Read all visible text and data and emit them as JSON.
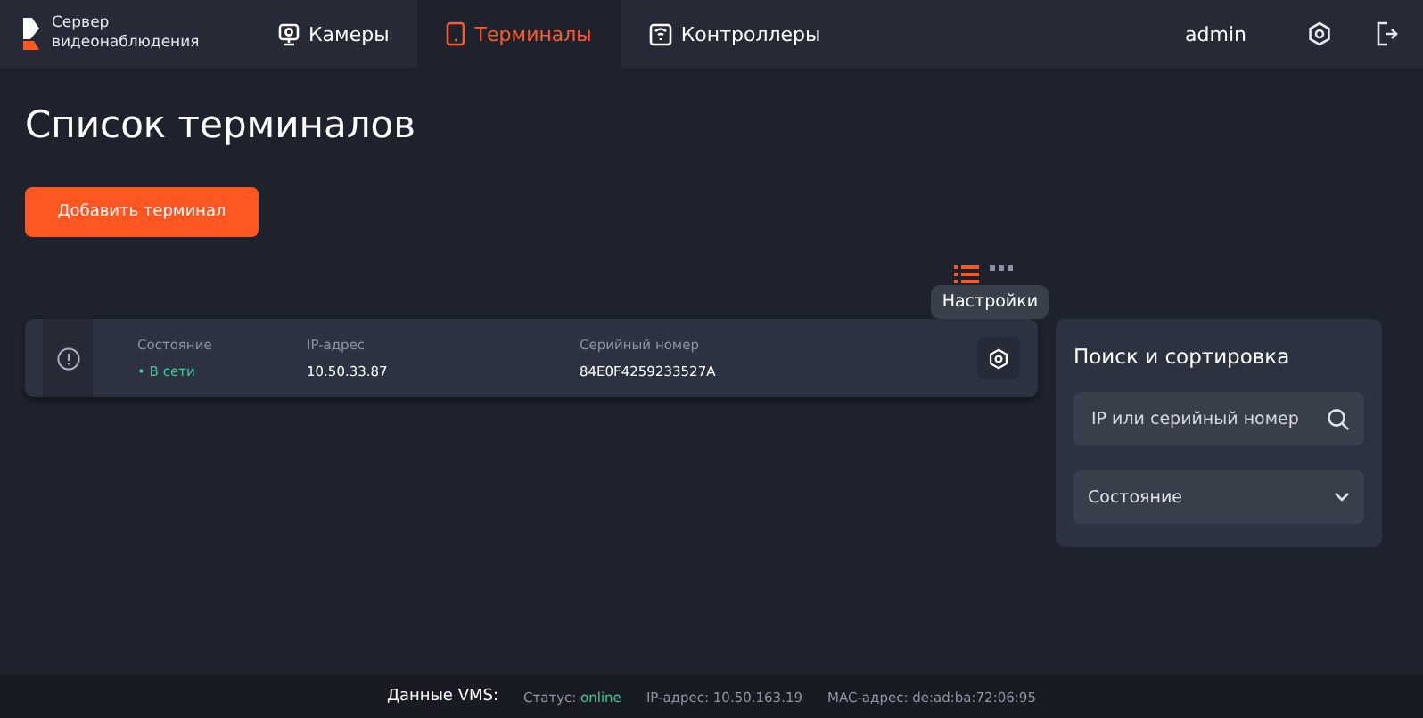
{
  "header": {
    "logo_text": "Сервер видеонаблюдения",
    "nav": [
      {
        "label": "Камеры",
        "selected": false
      },
      {
        "label": "Терминалы",
        "selected": true
      },
      {
        "label": "Контроллеры",
        "selected": false
      }
    ],
    "user": "admin"
  },
  "title": "Список терминалов",
  "add_button": "Добавить терминал",
  "view_toggles": [
    {
      "kind": "list",
      "selected": true
    },
    {
      "kind": "grid",
      "selected": false
    }
  ],
  "tooltip": "Настройки",
  "terminals": [
    {
      "online": true,
      "status_label": "Состояние",
      "status": "• В сети",
      "ip_label": "IP-адрес",
      "ip": "10.50.33.87",
      "serial_label": "Серийный номер",
      "serial": "84E0F4259233527A"
    }
  ],
  "search_panel": {
    "title": "Поиск и сортировка",
    "placeholder": "IP или серийный номер",
    "state_select": "Состояние"
  },
  "footer": {
    "label": "Данные VMS:",
    "status_label": "Статус:",
    "status": "online",
    "ip": "IP-адрес: 10.50.163.19",
    "mac": "MAC-адрес: de:ad:ba:72:06:95"
  }
}
